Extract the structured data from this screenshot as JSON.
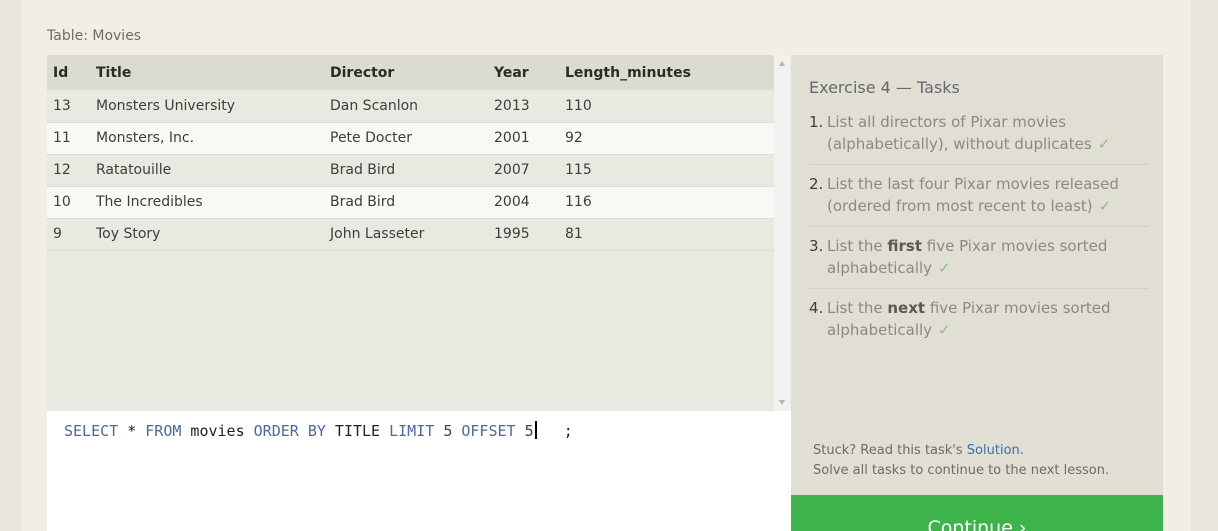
{
  "table": {
    "caption": "Table: Movies",
    "columns": [
      "Id",
      "Title",
      "Director",
      "Year",
      "Length_minutes"
    ],
    "rows": [
      [
        "13",
        "Monsters University",
        "Dan Scanlon",
        "2013",
        "110"
      ],
      [
        "11",
        "Monsters, Inc.",
        "Pete Docter",
        "2001",
        "92"
      ],
      [
        "12",
        "Ratatouille",
        "Brad Bird",
        "2007",
        "115"
      ],
      [
        "10",
        "The Incredibles",
        "Brad Bird",
        "2004",
        "116"
      ],
      [
        "9",
        "Toy Story",
        "John Lasseter",
        "1995",
        "81"
      ]
    ]
  },
  "editor": {
    "tokens": [
      {
        "t": "SELECT",
        "k": "kw"
      },
      {
        "t": " * ",
        "k": ""
      },
      {
        "t": "FROM",
        "k": "kw"
      },
      {
        "t": " movies ",
        "k": ""
      },
      {
        "t": "ORDER BY",
        "k": "kw"
      },
      {
        "t": " TITLE ",
        "k": ""
      },
      {
        "t": "LIMIT",
        "k": "kw"
      },
      {
        "t": " ",
        "k": ""
      },
      {
        "t": "5",
        "k": "num"
      },
      {
        "t": " ",
        "k": ""
      },
      {
        "t": "OFFSET",
        "k": "kw"
      },
      {
        "t": " ",
        "k": ""
      },
      {
        "t": "5",
        "k": "num"
      }
    ],
    "after_caret": "   ;"
  },
  "tasks": {
    "title": "Exercise 4 — Tasks",
    "items": [
      {
        "num": "1.",
        "parts": [
          {
            "t": "List all directors of Pixar movies (alphabetically), without duplicates",
            "b": false
          }
        ],
        "check": "✓"
      },
      {
        "num": "2.",
        "parts": [
          {
            "t": "List the last four Pixar movies released (ordered from most recent to least)",
            "b": false
          }
        ],
        "check": "✓"
      },
      {
        "num": "3.",
        "parts": [
          {
            "t": "List the ",
            "b": false
          },
          {
            "t": "first",
            "b": true
          },
          {
            "t": " five Pixar movies sorted alphabetically",
            "b": false
          }
        ],
        "check": "✓"
      },
      {
        "num": "4.",
        "parts": [
          {
            "t": "List the ",
            "b": false
          },
          {
            "t": "next",
            "b": true
          },
          {
            "t": " five Pixar movies sorted alphabetically",
            "b": false
          }
        ],
        "check": "✓"
      }
    ],
    "hint_prefix": "Stuck? Read this task's ",
    "hint_link": "Solution",
    "hint_suffix": ".",
    "hint_line2": "Solve all tasks to continue to the next lesson."
  },
  "continue_label": "Continue ›",
  "colors": {
    "continue": "#3cb44a",
    "keyword": "#4a68a8",
    "check": "#7fc47f",
    "link": "#3572b0"
  }
}
